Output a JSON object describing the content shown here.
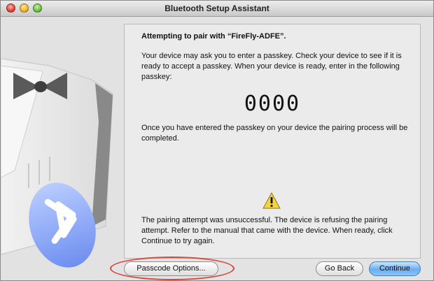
{
  "window": {
    "title": "Bluetooth Setup Assistant"
  },
  "pairing": {
    "heading": "Attempting to pair with “FireFly-ADFE”.",
    "instructions": "Your device may ask you to enter a passkey. Check your device to see if it is ready to accept a passkey. When your device is ready, enter in the following passkey:",
    "passkey": "0000",
    "completion_text": "Once you have entered the passkey on your device the pairing process will be completed.",
    "error_text": "The pairing attempt was unsuccessful. The device is refusing the pairing attempt. Refer to the manual that came with the device. When ready, click Continue to try again."
  },
  "buttons": {
    "passcode_options": "Passcode Options...",
    "go_back": "Go Back",
    "continue": "Continue"
  },
  "icons": {
    "warning": "warning-triangle-icon",
    "bluetooth": "bluetooth-icon"
  },
  "colors": {
    "highlight_circle": "#d9473a",
    "default_button": "#6aaef0",
    "bluetooth_badge": "#8fb3ff"
  }
}
